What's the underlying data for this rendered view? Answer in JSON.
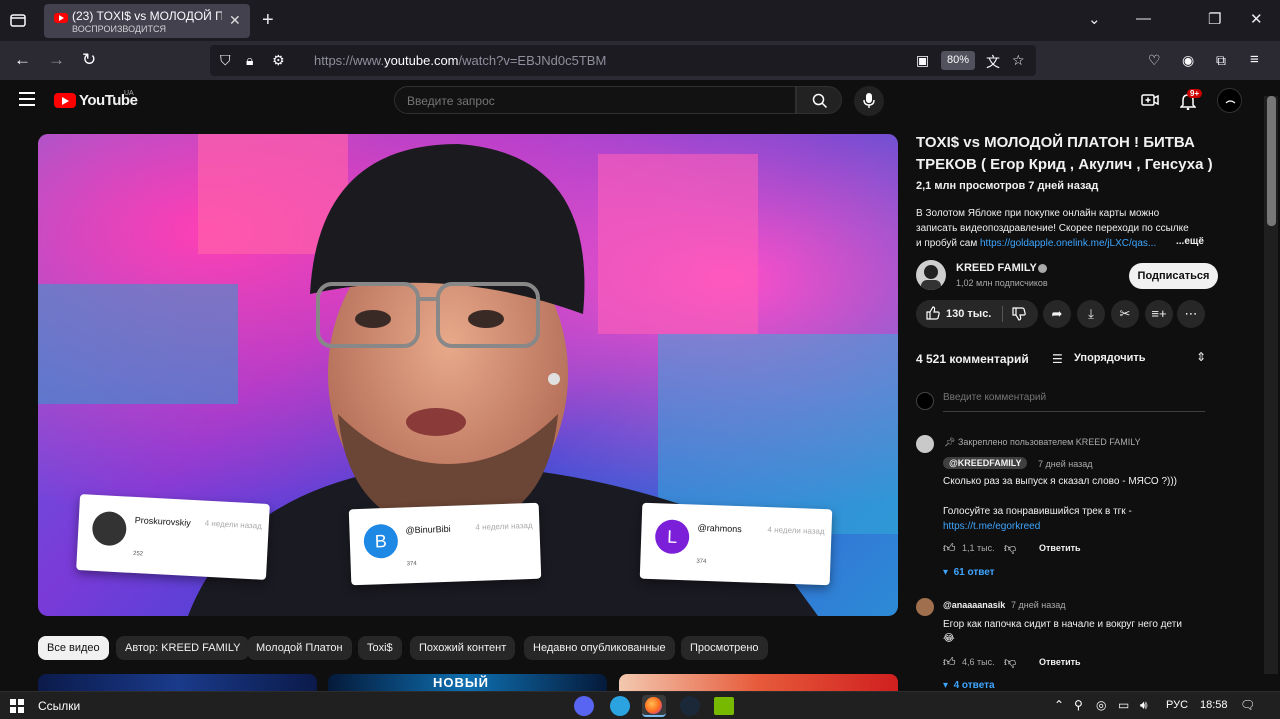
{
  "browser": {
    "tab": {
      "title": "(23) TOXI$ vs МОЛОДОЙ ПЛАТОН ! БИТВА ТРЕКОВ",
      "subtitle": "ВОСПРОИЗВОДИТСЯ"
    },
    "url_prefix": "https://www.",
    "url_host": "youtube.com",
    "url_path": "/watch?v=EBJNd0c5TBM",
    "zoom": "80%"
  },
  "youtube": {
    "logo_text": "YouTube",
    "country": "UA",
    "search_placeholder": "Введите запрос",
    "bell_badge": "9+"
  },
  "video": {
    "title": "TOXI$ vs МОЛОДОЙ ПЛАТОН ! БИТВА ТРЕКОВ ( Егор Крид , Акулич , Генсуха )",
    "meta": "2,1 млн просмотров  7 дней назад",
    "description_line1": "В Золотом Яблоке при покупке онлайн карты можно",
    "description_line2": "записать видеопоздравление! Скорее переходи по ссылке",
    "description_line3": "и пробуй сам",
    "description_link": "https://goldapple.onelink.me/jLXC/qas...",
    "more": "...ещё",
    "cards": [
      {
        "name": "Proskurovskiy",
        "time": "4 недели назад",
        "likes": "252",
        "avatar": "",
        "color": "#333"
      },
      {
        "name": "@BinurBibi",
        "time": "4 недели назад",
        "likes": "374",
        "avatar": "B",
        "color": "#1e88e5"
      },
      {
        "name": "@rahmons",
        "time": "4 недели назад",
        "likes": "374",
        "avatar": "L",
        "color": "#7b1fd8"
      }
    ]
  },
  "channel": {
    "name": "KREED FAMILY",
    "subscribers": "1,02 млн подписчиков",
    "subscribe_label": "Подписаться"
  },
  "actions": {
    "likes": "130 тыс."
  },
  "chips": [
    "Все видео",
    "Автор: KREED FAMILY",
    "Молодой Платон",
    "Toxi$",
    "Похожий контент",
    "Недавно опубликованные",
    "Просмотрено"
  ],
  "thumbs": [
    {
      "label": ""
    },
    {
      "label": "НОВЫЙ"
    },
    {
      "label": ""
    }
  ],
  "comments": {
    "count": "4 521 комментарий",
    "sort_label": "Упорядочить",
    "input_placeholder": "Введите комментарий",
    "pinned_label": "Закреплено пользователем KREED FAMILY",
    "items": [
      {
        "author": "@KREEDFAMILY",
        "time": "7 дней назад",
        "text1": "Сколько раз за выпуск я сказал слово - МЯСО ?)))",
        "text2": "Голосуйте за понравившийся трек в тгк -",
        "link": "https://t.me/egorkreed",
        "likes": "1,1 тыс.",
        "reply": "Ответить",
        "replies": "61 ответ"
      },
      {
        "author": "@anaaaanasik",
        "time": "7 дней назад",
        "text1": "Егор как папочка сидит в начале и вокруг него дети",
        "text2": "😂",
        "likes": "4,6 тыс.",
        "reply": "Ответить",
        "replies": "4 ответа"
      }
    ]
  },
  "taskbar": {
    "links_label": "Ссылки",
    "lang": "РУС",
    "time": "18:58"
  }
}
